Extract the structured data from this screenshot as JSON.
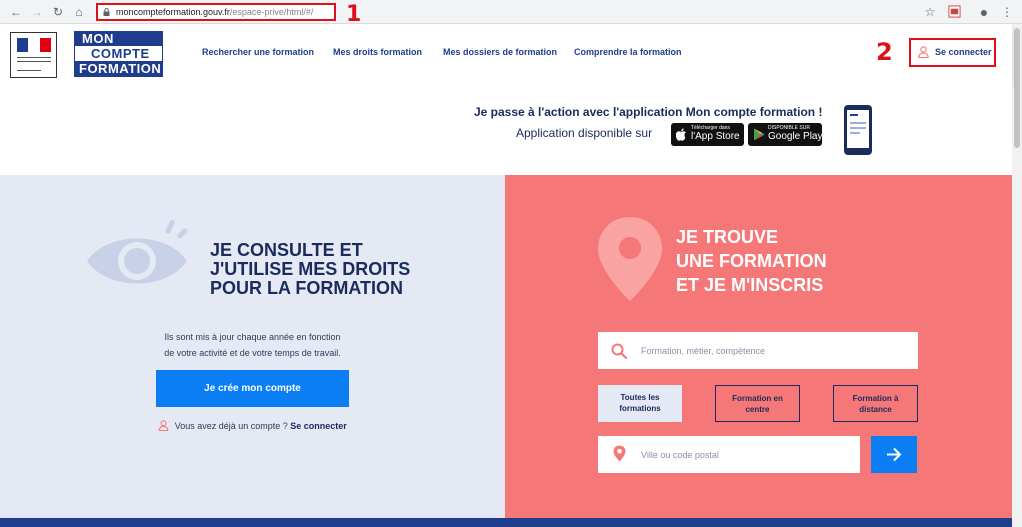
{
  "browser": {
    "url_host": "moncompteformation.gouv.fr",
    "url_path": "/espace-prive/html/#/",
    "markers": [
      "1",
      "2"
    ]
  },
  "header": {
    "logo": {
      "line1": "MON",
      "line2": "COMPTE",
      "line3": "FORMATION"
    },
    "nav": [
      {
        "label": "Rechercher une formation"
      },
      {
        "label": "Mes droits formation"
      },
      {
        "label": "Mes dossiers de formation"
      },
      {
        "label": "Comprendre la formation"
      }
    ],
    "login_label": "Se connecter"
  },
  "app_banner": {
    "line1": "Je passe à l'action avec l'application Mon compte formation !",
    "line2": "Application disponible sur",
    "app_store": {
      "small": "Télécharger dans",
      "big": "l'App Store"
    },
    "google_play": {
      "small": "DISPONIBLE SUR",
      "big": "Google Play"
    }
  },
  "left": {
    "title_lines": [
      "JE CONSULTE ET",
      "J'UTILISE MES DROITS",
      "POUR LA FORMATION"
    ],
    "desc_line1": "Ils sont mis à jour chaque année en fonction",
    "desc_line2": "de votre activité et de votre temps de travail.",
    "create_label": "Je crée mon compte",
    "have_account": "Vous avez déjà un compte ?",
    "login_link": "Se connecter"
  },
  "right": {
    "title_lines": [
      "JE TROUVE",
      "UNE FORMATION",
      "ET JE M'INSCRIS"
    ],
    "search_placeholder": "Formation, métier, compétence",
    "modes": [
      {
        "line1": "Toutes les",
        "line2": "formations",
        "active": true
      },
      {
        "line1": "Formation en",
        "line2": "centre",
        "active": false
      },
      {
        "line1": "Formation à",
        "line2": "distance",
        "active": false
      }
    ],
    "location_placeholder": "Ville ou code postal"
  },
  "colors": {
    "navy": "#1f3d8f",
    "salmon": "#f67777",
    "light_blue": "#e5e9f4",
    "button_blue": "#0a7ef2",
    "annotation_red": "#e0101b"
  }
}
